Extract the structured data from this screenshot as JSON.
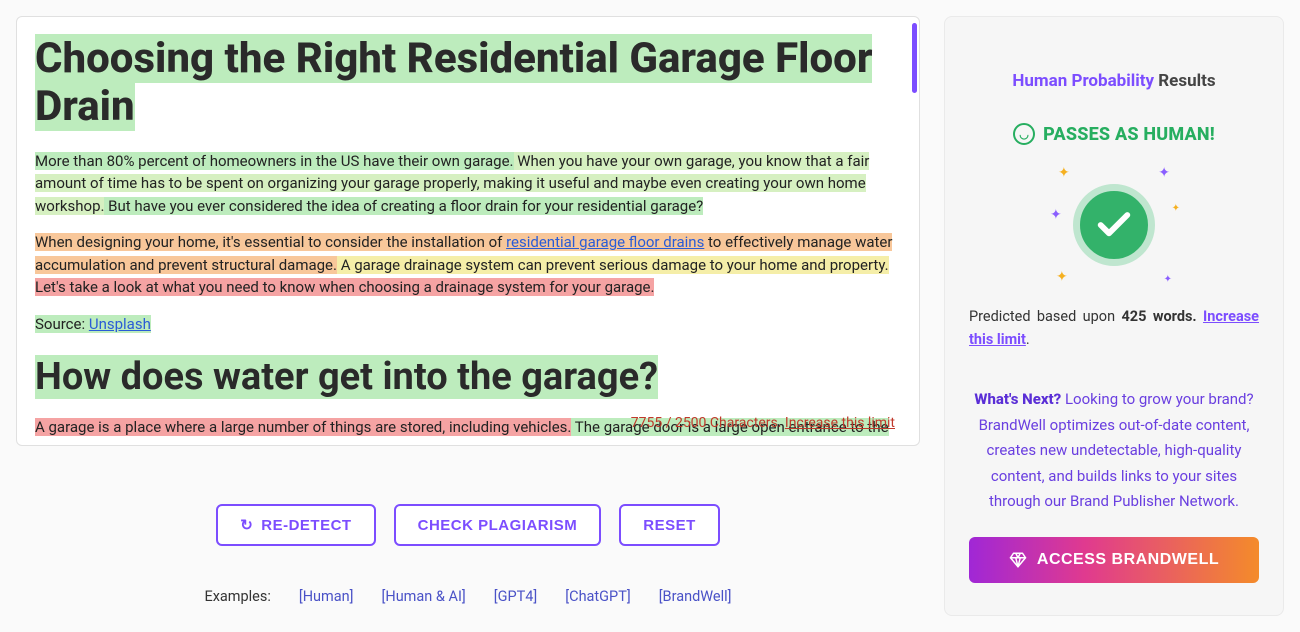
{
  "editor": {
    "title": "Choosing the Right Residential Garage Floor Drain",
    "p1_seg1": "More than 80% percent of homeowners in the US have their own garage.",
    "p1_seg2": " When you have your own garage, you know that a fair amount of time has to be spent on organizing your garage properly, making it useful and maybe even creating your own home workshop.",
    "p1_seg3": " But have you ever considered the idea of creating a floor drain for your residential garage?",
    "p2_seg1": "When designing your home, it's essential to consider the installation of ",
    "p2_link": "residential garage floor drains",
    "p2_seg2": " to effectively manage water accumulation and prevent structural damage.",
    "p2_seg3": " A garage drainage system can prevent serious damage to your home and property.",
    "p2_seg4": " Let's take a look at what you need to know when choosing a drainage system for your garage.",
    "source_label": "Source: ",
    "source_link": "Unsplash",
    "heading2": "How does water get into the garage?",
    "p3_seg1": "A garage is a place where a large number of things are stored, including vehicles.",
    "p3_seg2": " The garage door is a large open entrance to the",
    "char_counter": "7755 / 2500 Characters. ",
    "char_increase": "Increase this limit"
  },
  "actions": {
    "redetect": "RE-DETECT",
    "plagiarism": "CHECK PLAGIARISM",
    "reset": "RESET"
  },
  "examples": {
    "label": "Examples:",
    "items": [
      "[Human]",
      "[Human & AI]",
      "[GPT4]",
      "[ChatGPT]",
      "[BrandWell]"
    ]
  },
  "results": {
    "title_part1": "Human Probability ",
    "title_part2": "Results",
    "passes_label": "PASSES AS HUMAN!",
    "predicted_prefix": "Predicted based upon ",
    "word_count": "425 words.",
    "predicted_link": "Increase this limit",
    "predicted_suffix": ".",
    "whatsnext_lead": "What's Next? ",
    "whatsnext_body": "Looking to grow your brand? BrandWell optimizes out-of-date content, creates new undetectable, high-quality content, and builds links to your sites through our Brand Publisher Network.",
    "access_label": "ACCESS BRANDWELL"
  }
}
